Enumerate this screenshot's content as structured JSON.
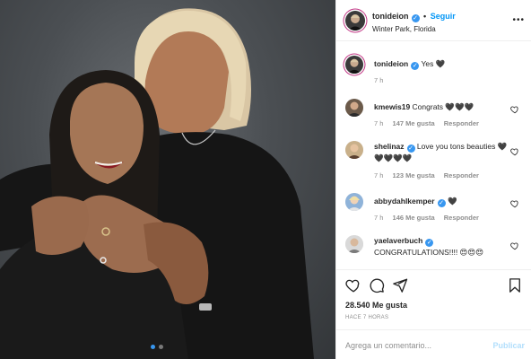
{
  "post": {
    "author": {
      "username": "tonideion",
      "location": "Winter Park, Florida",
      "follow_label": "Seguir",
      "separator": "•",
      "more_icon": "more-horizontal-icon"
    },
    "caption": {
      "username": "tonideion",
      "text": "Yes 🖤",
      "time": "7 h"
    },
    "comments": [
      {
        "username": "kmewis19",
        "verified": false,
        "text": "Congrats 🖤🖤🖤",
        "time": "7 h",
        "likes": "147 Me gusta",
        "reply": "Responder"
      },
      {
        "username": "shelinaz",
        "verified": true,
        "text": "Love you tons beauties 🖤🖤🖤🖤🖤",
        "time": "7 h",
        "likes": "123 Me gusta",
        "reply": "Responder"
      },
      {
        "username": "abbydahlkemper",
        "verified": true,
        "text": "🖤",
        "time": "7 h",
        "likes": "146 Me gusta",
        "reply": "Responder"
      },
      {
        "username": "yaelaverbuch",
        "verified": true,
        "text": "CONGRATULATIONS!!!! 😍😍😍",
        "time": "",
        "likes": "",
        "reply": ""
      }
    ],
    "likes_count": "28.540 Me gusta",
    "posted": "HACE 7 HORAS",
    "comment_input": {
      "placeholder": "Agrega un comentario...",
      "value": ""
    },
    "publish_label": "Publicar",
    "carousel": {
      "count": 2,
      "active_index": 0
    }
  },
  "colors": {
    "accent": "#0095f6",
    "verified": "#3897f0",
    "muted": "#8e8e8e",
    "text": "#262626",
    "publish_disabled": "#b2dffc"
  }
}
